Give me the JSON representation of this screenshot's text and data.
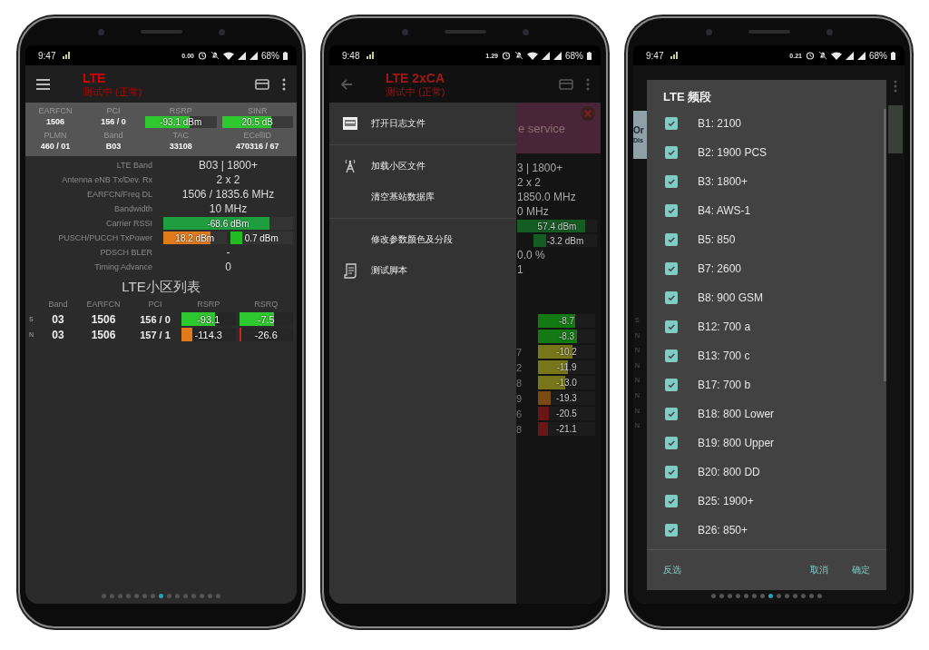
{
  "phones": [
    {
      "kind": "monitor",
      "status_bar": {
        "time": "9:47",
        "speed": "0.00",
        "battery": "68%"
      },
      "app_bar": {
        "title": "LTE",
        "subtitle": "测试中 (正常)"
      },
      "summary": [
        [
          {
            "kind": "text",
            "label": "EARFCN",
            "value": "1506"
          },
          {
            "kind": "text",
            "label": "PCI",
            "value": "156 / 0"
          },
          {
            "kind": "bar",
            "label": "RSRP",
            "bar": {
              "text": "-93.1 dBm",
              "level": 0.62,
              "color": "#2ec92e"
            }
          },
          {
            "kind": "bar",
            "label": "SINR",
            "bar": {
              "text": "20.5 dB",
              "level": 0.7,
              "color": "#2ec92e"
            }
          }
        ],
        [
          {
            "kind": "text",
            "label": "PLMN",
            "value": "460 / 01"
          },
          {
            "kind": "text",
            "label": "Band",
            "value": "B03"
          },
          {
            "kind": "text",
            "label": "TAC",
            "value": "33108"
          },
          {
            "kind": "text",
            "label": "ECellID",
            "value": "470316 / 67"
          }
        ]
      ],
      "details": [
        {
          "kind": "text",
          "label": "LTE Band",
          "value": "B03 | 1800+"
        },
        {
          "kind": "text",
          "label": "Antenna eNB Tx/Dev. Rx",
          "value": "2 x 2"
        },
        {
          "kind": "text",
          "label": "EARFCN/Freq DL",
          "value": "1506 / 1835.6 MHz"
        },
        {
          "kind": "text",
          "label": "Bandwidth",
          "value": "10 MHz"
        },
        {
          "kind": "bar",
          "label": "Carrier RSSI",
          "bars": [
            {
              "text": "-68.6 dBm",
              "level": 0.82,
              "color": "#1f9e3f"
            }
          ]
        },
        {
          "kind": "bar",
          "label": "PUSCH/PUCCH TxPower",
          "bars": [
            {
              "text": "18.2 dBm",
              "level": 0.75,
              "color": "#e07b1c"
            },
            {
              "text": "0.7 dBm",
              "level": 0.2,
              "color": "#22bb22"
            }
          ]
        },
        {
          "kind": "text",
          "label": "PDSCH BLER",
          "value": "-"
        },
        {
          "kind": "text",
          "label": "Timing Advance",
          "value": "0"
        }
      ],
      "cell_list": {
        "title": "LTE小区列表",
        "columns": [
          "Band",
          "EARFCN",
          "PCI",
          "RSRP",
          "RSRQ"
        ],
        "rows": [
          {
            "type": "S",
            "band": "03",
            "earfcn": "1506",
            "pci": "156 / 0",
            "rsrp": {
              "text": "-93.1",
              "level": 0.62,
              "color": "#2ec92e"
            },
            "rsrq": {
              "text": "-7.5",
              "level": 0.65,
              "color": "#2ec92e"
            }
          },
          {
            "type": "N",
            "band": "03",
            "earfcn": "1506",
            "pci": "157 / 1",
            "rsrp": {
              "text": "-114.3",
              "level": 0.2,
              "color": "#e07b1c"
            },
            "rsrq": {
              "text": "-26.6",
              "level": 0.05,
              "color": "#cc2222"
            }
          }
        ]
      },
      "page_dots": [
        {
          "selected": false
        },
        {
          "selected": false
        },
        {
          "selected": false
        },
        {
          "selected": false
        },
        {
          "selected": false
        },
        {
          "selected": false
        },
        {
          "selected": false
        },
        {
          "selected": true
        },
        {
          "selected": false
        },
        {
          "selected": false
        },
        {
          "selected": false
        },
        {
          "selected": false
        },
        {
          "selected": false
        },
        {
          "selected": false
        },
        {
          "selected": false
        }
      ]
    },
    {
      "kind": "drawer",
      "status_bar": {
        "time": "9:48",
        "speed": "1.29",
        "battery": "68%"
      },
      "app_bar": {
        "title": "LTE 2xCA",
        "subtitle": "测试中 (正常)"
      },
      "drawer": [
        [
          {
            "kind": "log",
            "label": "打开日志文件"
          }
        ],
        [
          {
            "kind": "cells",
            "label": "加载小区文件"
          },
          {
            "kind": "clear",
            "label": "清空基站数据库"
          }
        ],
        [
          {
            "kind": "colors",
            "label": "修改参数颜色及分段"
          },
          {
            "kind": "script",
            "label": "测试脚本"
          }
        ]
      ],
      "background": {
        "banner_text": "e service",
        "lines": [
          {
            "kind": "text",
            "value": "3 | 1800+"
          },
          {
            "kind": "text",
            "value": "2 x 2"
          },
          {
            "kind": "text",
            "value": "1850.0 MHz"
          },
          {
            "kind": "text",
            "value": "0 MHz"
          },
          {
            "kind": "bar",
            "bar": {
              "text": "57.4 dBm",
              "level": 0.85,
              "color": "#145c22"
            }
          },
          {
            "kind": "bar-right",
            "bar": {
              "text": "-3.2 dBm",
              "level": 0.2,
              "color": "#145c22"
            }
          },
          {
            "kind": "text",
            "value": "0.0 %"
          },
          {
            "kind": "text",
            "value": "1"
          }
        ],
        "cell_rows": [
          {
            "pci": "",
            "rsrq": {
              "text": "-8.7",
              "level": 0.65,
              "color": "#137a13"
            }
          },
          {
            "pci": "",
            "rsrq": {
              "text": "-8.3",
              "level": 0.68,
              "color": "#137a13"
            }
          },
          {
            "pci": "7",
            "rsrq": {
              "text": "-10.2",
              "level": 0.6,
              "color": "#77771a"
            }
          },
          {
            "pci": "2",
            "rsrq": {
              "text": "-11.9",
              "level": 0.52,
              "color": "#77771a"
            }
          },
          {
            "pci": "8",
            "rsrq": {
              "text": "-13.0",
              "level": 0.48,
              "color": "#77771a"
            }
          },
          {
            "pci": "9",
            "rsrq": {
              "text": "-19.3",
              "level": 0.22,
              "color": "#7a4a12"
            }
          },
          {
            "pci": "6",
            "rsrq": {
              "text": "-20.5",
              "level": 0.19,
              "color": "#6a1616"
            }
          },
          {
            "pci": "8",
            "rsrq": {
              "text": "-21.1",
              "level": 0.18,
              "color": "#6a1616"
            }
          }
        ]
      }
    },
    {
      "kind": "dialog",
      "status_bar": {
        "time": "9:47",
        "speed": "0.21",
        "battery": "68%"
      },
      "background": {
        "banner_texts": [
          "Or",
          "Dis"
        ],
        "cell_types": [
          "S",
          "N",
          "N",
          "N",
          "N",
          "N",
          "N",
          "N"
        ]
      },
      "dialog": {
        "title": "LTE 频段",
        "options": [
          {
            "label": "B1: 2100",
            "checked": true
          },
          {
            "label": "B2: 1900 PCS",
            "checked": true
          },
          {
            "label": "B3: 1800+",
            "checked": true
          },
          {
            "label": "B4: AWS-1",
            "checked": true
          },
          {
            "label": "B5: 850",
            "checked": true
          },
          {
            "label": "B7: 2600",
            "checked": true
          },
          {
            "label": "B8: 900 GSM",
            "checked": true
          },
          {
            "label": "B12: 700 a",
            "checked": true
          },
          {
            "label": "B13: 700 c",
            "checked": true
          },
          {
            "label": "B17: 700 b",
            "checked": true
          },
          {
            "label": "B18: 800 Lower",
            "checked": true
          },
          {
            "label": "B19: 800 Upper",
            "checked": true
          },
          {
            "label": "B20: 800 DD",
            "checked": true
          },
          {
            "label": "B25: 1900+",
            "checked": true
          },
          {
            "label": "B26: 850+",
            "checked": true
          }
        ],
        "buttons": [
          {
            "label": "反选"
          },
          {
            "label": "取消"
          },
          {
            "label": "确定"
          }
        ]
      },
      "page_dots": [
        {
          "selected": false
        },
        {
          "selected": false
        },
        {
          "selected": false
        },
        {
          "selected": false
        },
        {
          "selected": false
        },
        {
          "selected": false
        },
        {
          "selected": false
        },
        {
          "selected": true
        },
        {
          "selected": false
        },
        {
          "selected": false
        },
        {
          "selected": false
        },
        {
          "selected": false
        },
        {
          "selected": false
        },
        {
          "selected": false
        }
      ]
    }
  ]
}
